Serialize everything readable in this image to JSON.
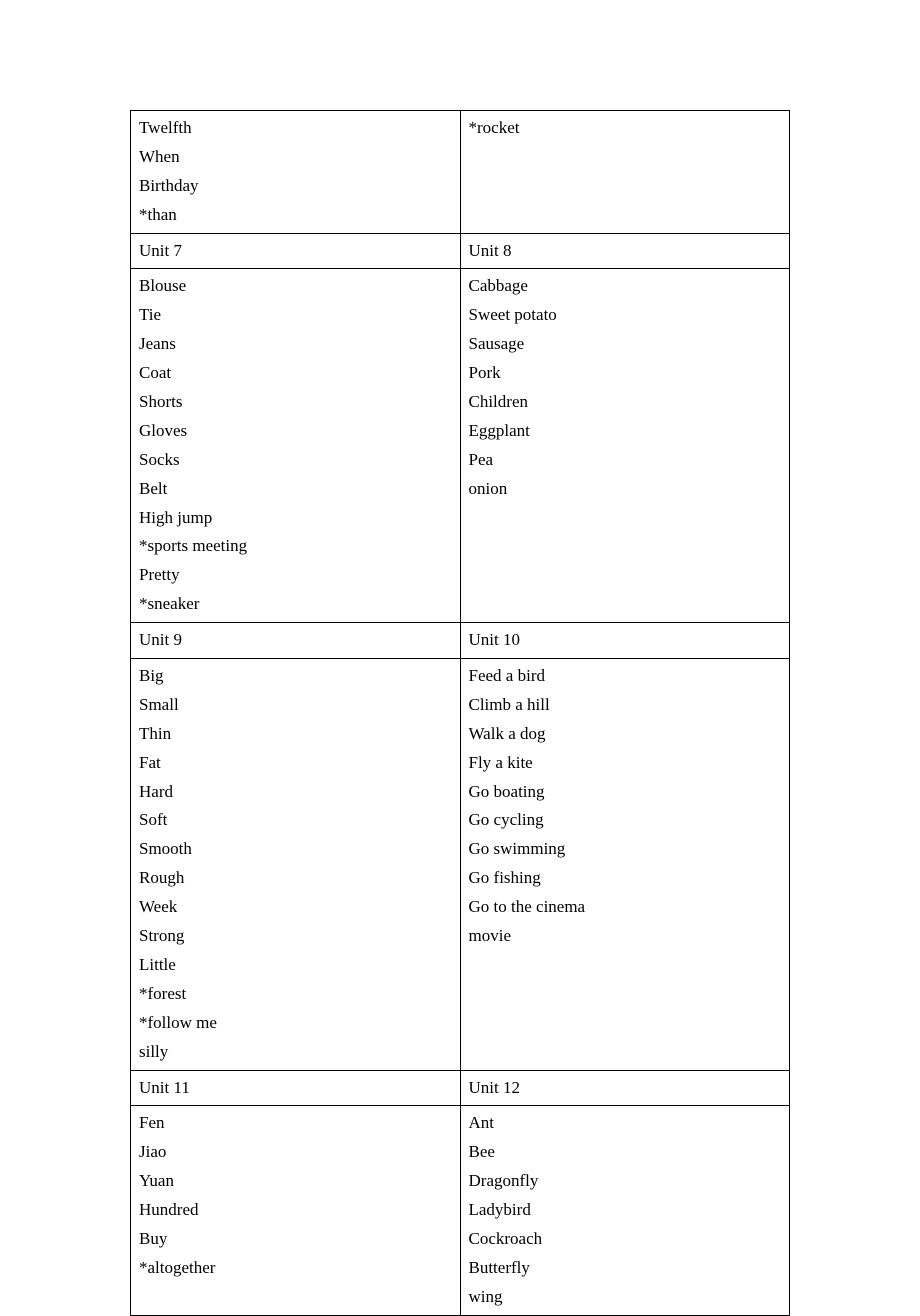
{
  "rows": [
    {
      "left": "Twelfth\nWhen\nBirthday\n*than",
      "right": "*rocket"
    },
    {
      "left": "Unit 7",
      "right": "Unit 8"
    },
    {
      "left": "Blouse\nTie\nJeans\nCoat\nShorts\nGloves\nSocks\nBelt\nHigh jump\n*sports meeting\nPretty\n*sneaker",
      "right": "Cabbage\nSweet potato\nSausage\nPork\nChildren\nEggplant\nPea\nonion"
    },
    {
      "left": "Unit 9",
      "right": "Unit 10"
    },
    {
      "left": "Big\nSmall\nThin\nFat\nHard\nSoft\nSmooth\nRough\nWeek\nStrong\nLittle\n*forest\n*follow me\nsilly",
      "right": "Feed a bird\nClimb a hill\nWalk a dog\nFly a kite\nGo boating\nGo cycling\nGo swimming\nGo fishing\nGo to the cinema\nmovie"
    },
    {
      "left": "Unit 11",
      "right": "Unit 12"
    },
    {
      "left": "Fen\nJiao\nYuan\nHundred\nBuy\n*altogether",
      "right": "Ant\nBee\nDragonfly\nLadybird\nCockroach\nButterfly\nwing"
    }
  ]
}
